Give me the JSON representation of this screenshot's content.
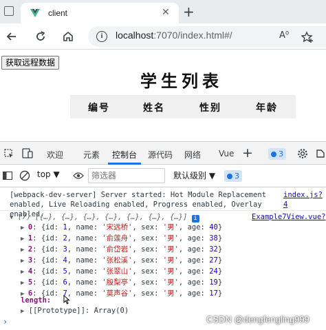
{
  "browser": {
    "tab_title": "client",
    "tab_close": "✕",
    "new_tab": "+",
    "url_host": "localhost",
    "url_rest": ":7070/index.html#/",
    "font_icon": "A⁰",
    "icons": [
      "back-arrow-icon",
      "reload-icon",
      "home-icon",
      "info-icon",
      "read-aloud-icon",
      "favorites-add-icon"
    ]
  },
  "page": {
    "fetch_button": "获取远程数据",
    "title": "学生列表",
    "headers": [
      "编号",
      "姓名",
      "性别",
      "年龄"
    ]
  },
  "devtools": {
    "tabs": [
      "欢迎",
      "元素",
      "控制台",
      "源代码",
      "网络",
      "Vue"
    ],
    "active_tab": "控制台",
    "issues_count": "3",
    "context": "top",
    "filter_placeholder": "筛选器",
    "level": "默认级别",
    "level_count": "3",
    "log_message": "[webpack-dev-server] Server started: Hot Module Replacement enabled, Live Reloading enabled, Progress enabled, Overlay enabled.",
    "log_source": "index.js?4",
    "array_preview": "(7) [{…}, {…}, {…}, {…}, {…}, {…}, {…}]",
    "array_source": "Example7View.vue?",
    "students": [
      {
        "index": "0",
        "id": "1",
        "name": "'宋远桥'",
        "sex": "'男'",
        "age": "40"
      },
      {
        "index": "1",
        "id": "2",
        "name": "'俞莲舟'",
        "sex": "'男'",
        "age": "38"
      },
      {
        "index": "2",
        "id": "3",
        "name": "'俞岱岩'",
        "sex": "'男'",
        "age": "32"
      },
      {
        "index": "3",
        "id": "4",
        "name": "'张松溪'",
        "sex": "'男'",
        "age": "27"
      },
      {
        "index": "4",
        "id": "5",
        "name": "'张翠山'",
        "sex": "'男'",
        "age": "24"
      },
      {
        "index": "5",
        "id": "6",
        "name": "'殷梨亭'",
        "sex": "'男'",
        "age": "19"
      },
      {
        "index": "6",
        "id": "7",
        "name": "'莫声谷'",
        "sex": "'男'",
        "age": "17"
      }
    ],
    "length_label": "length:",
    "prototype_label": "[[Prototype]]: Array(0)",
    "prompt": "›"
  },
  "watermark": "CSDN @dengfengling999",
  "colors": {
    "accent": "#1a73e8",
    "vue_green": "#41b883",
    "string_red": "#c41a16",
    "number_blue": "#1c00cf",
    "key_purple": "#881280"
  }
}
